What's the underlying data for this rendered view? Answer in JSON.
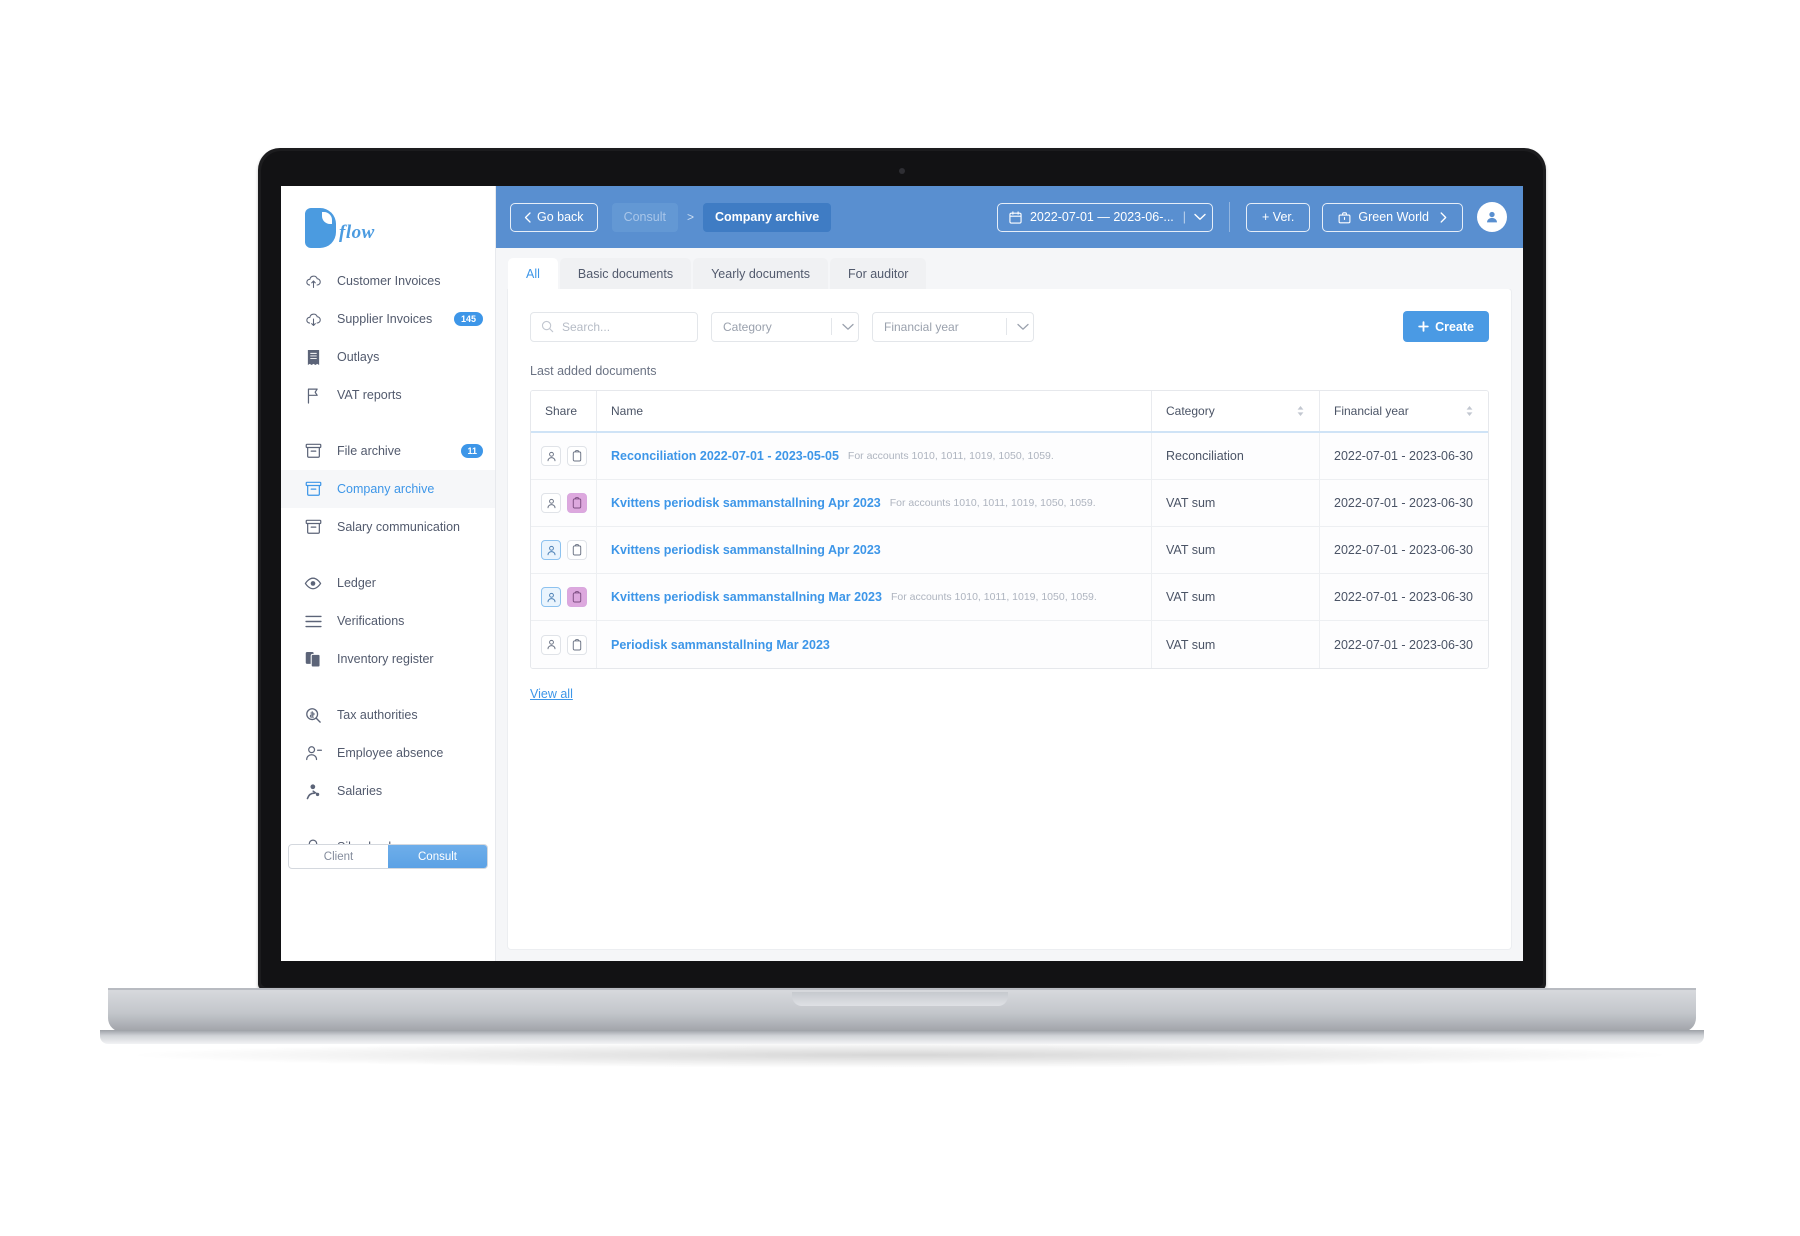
{
  "brand": {
    "logo_word": "flow",
    "accent": "#4b9be0",
    "header_bg": "#598fd0",
    "link_color": "#3d96e8"
  },
  "sidebar": {
    "groups": [
      {
        "items": [
          {
            "label": "Customer Invoices",
            "icon": "cloud-upload-icon",
            "badge": null,
            "active": false
          },
          {
            "label": "Supplier Invoices",
            "icon": "cloud-download-icon",
            "badge": "145",
            "active": false
          },
          {
            "label": "Outlays",
            "icon": "receipt-icon",
            "badge": null,
            "active": false
          },
          {
            "label": "VAT reports",
            "icon": "flag-icon",
            "badge": null,
            "active": false
          }
        ]
      },
      {
        "items": [
          {
            "label": "File archive",
            "icon": "archive-box-icon",
            "badge": "11",
            "active": false
          },
          {
            "label": "Company archive",
            "icon": "archive-box-icon",
            "badge": null,
            "active": true
          },
          {
            "label": "Salary communication",
            "icon": "archive-box-icon",
            "badge": null,
            "active": false
          }
        ]
      },
      {
        "items": [
          {
            "label": "Ledger",
            "icon": "eye-icon",
            "badge": null,
            "active": false
          },
          {
            "label": "Verifications",
            "icon": "list-lines-icon",
            "badge": null,
            "active": false
          },
          {
            "label": "Inventory register",
            "icon": "clipboard-stack-icon",
            "badge": null,
            "active": false
          }
        ]
      },
      {
        "items": [
          {
            "label": "Tax authorities",
            "icon": "magnifier-coin-icon",
            "badge": null,
            "active": false
          },
          {
            "label": "Employee absence",
            "icon": "person-minus-icon",
            "badge": null,
            "active": false
          },
          {
            "label": "Salaries",
            "icon": "person-coin-icon",
            "badge": null,
            "active": false
          }
        ]
      },
      {
        "items": [
          {
            "label": "Silverback",
            "icon": "medal-icon",
            "badge": null,
            "active": false
          }
        ]
      }
    ],
    "role_toggle": {
      "client_label": "Client",
      "consult_label": "Consult",
      "selected": "Consult"
    }
  },
  "topbar": {
    "go_back_label": "Go back",
    "breadcrumb_parent": "Consult",
    "breadcrumb_separator": ">",
    "breadcrumb_current": "Company archive",
    "date_range": "2022-07-01 — 2023-06-...",
    "add_ver_label": "+ Ver.",
    "company_label": "Green World"
  },
  "tabs": [
    {
      "label": "All",
      "active": true
    },
    {
      "label": "Basic documents",
      "active": false
    },
    {
      "label": "Yearly documents",
      "active": false
    },
    {
      "label": "For auditor",
      "active": false
    }
  ],
  "filters": {
    "search_placeholder": "Search...",
    "category_placeholder": "Category",
    "financial_year_placeholder": "Financial year",
    "create_label": "Create"
  },
  "table": {
    "section_label": "Last added documents",
    "headers": {
      "share": "Share",
      "name": "Name",
      "category": "Category",
      "financial_year": "Financial year"
    },
    "rows": [
      {
        "person_state": "default",
        "clipboard_state": "default",
        "name": "Reconciliation 2022-07-01 - 2023-05-05",
        "name_bold": true,
        "subtitle": "For accounts 1010, 1011, 1019, 1050, 1059.",
        "category": "Reconciliation",
        "financial_year": "2022-07-01 - 2023-06-30"
      },
      {
        "person_state": "default",
        "clipboard_state": "purple",
        "name": "Kvittens periodisk sammanstallning Apr 2023",
        "name_bold": true,
        "subtitle": "For accounts 1010, 1011, 1019, 1050, 1059.",
        "category": "VAT sum",
        "financial_year": "2022-07-01 - 2023-06-30"
      },
      {
        "person_state": "blue",
        "clipboard_state": "default",
        "name": "Kvittens periodisk sammanstallning Apr 2023",
        "name_bold": true,
        "subtitle": "",
        "category": "VAT sum",
        "financial_year": "2022-07-01 - 2023-06-30"
      },
      {
        "person_state": "blue",
        "clipboard_state": "purple",
        "name": "Kvittens periodisk sammanstallning Mar 2023",
        "name_bold": true,
        "subtitle": "For accounts 1010, 1011, 1019, 1050, 1059.",
        "category": "VAT sum",
        "financial_year": "2022-07-01 - 2023-06-30"
      },
      {
        "person_state": "default",
        "clipboard_state": "default",
        "name": "Periodisk sammanstallning Mar 2023",
        "name_bold": true,
        "subtitle": "",
        "category": "VAT sum",
        "financial_year": "2022-07-01 - 2023-06-30"
      }
    ],
    "view_all_label": "View all"
  }
}
